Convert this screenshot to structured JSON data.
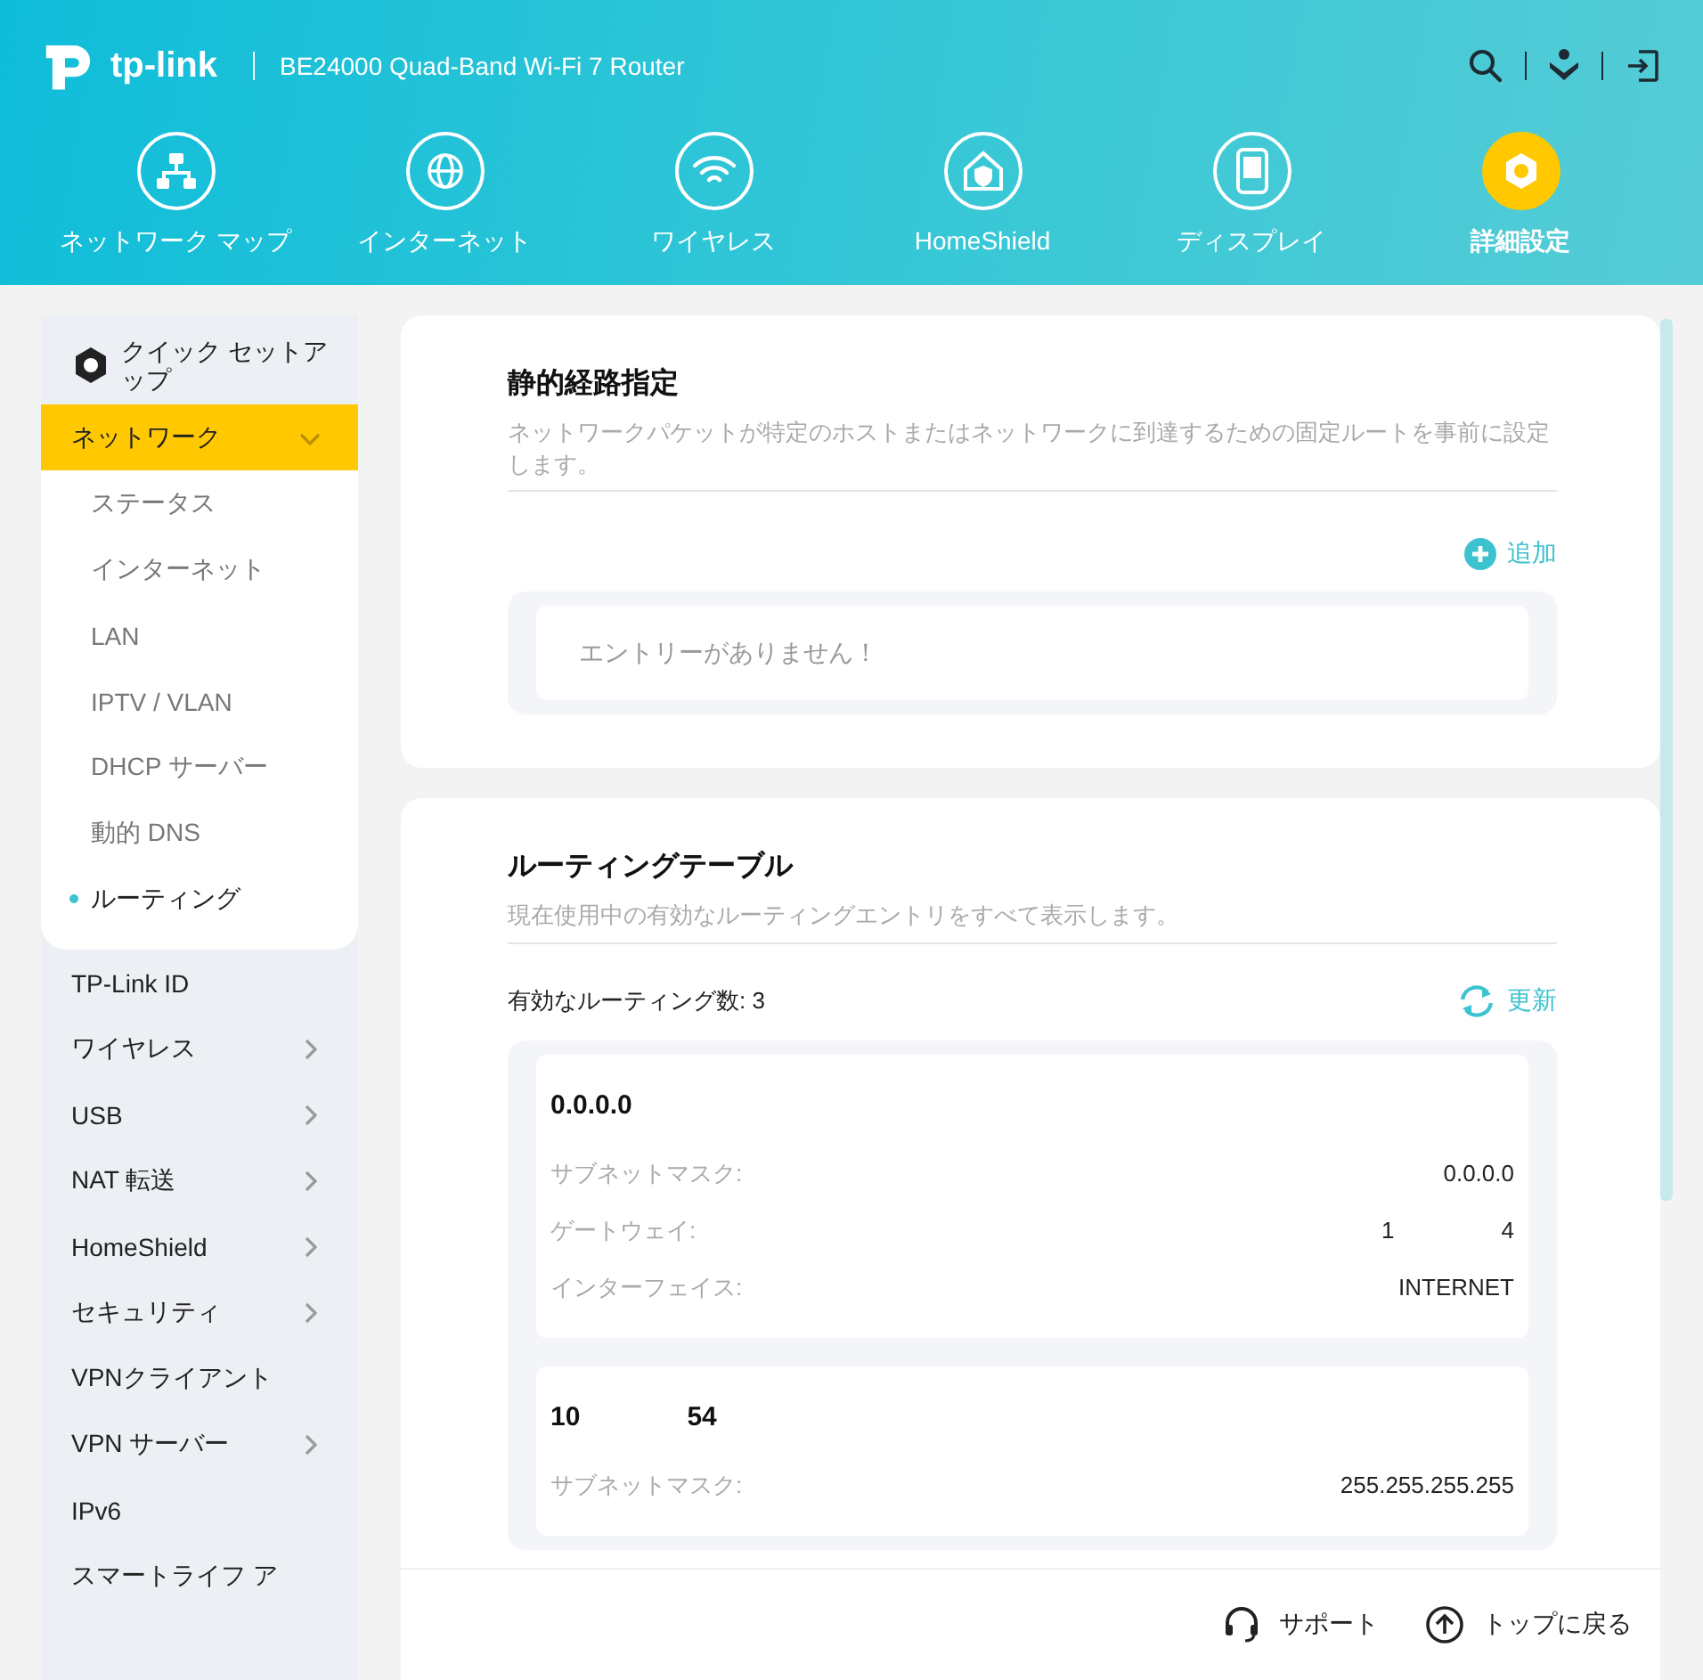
{
  "header": {
    "logo": "tp-link",
    "model": "BE24000 Quad-Band Wi-Fi 7 Router"
  },
  "nav_tabs": [
    {
      "label": "ネットワーク マップ",
      "kind": "map",
      "selected": false
    },
    {
      "label": "インターネット",
      "kind": "globe",
      "selected": false
    },
    {
      "label": "ワイヤレス",
      "kind": "wifi",
      "selected": false
    },
    {
      "label": "HomeShield",
      "kind": "home",
      "selected": false
    },
    {
      "label": "ディスプレイ",
      "kind": "display",
      "selected": false
    },
    {
      "label": "詳細設定",
      "kind": "gear",
      "selected": true
    }
  ],
  "sidebar": {
    "top": {
      "label": "クイック セットアップ"
    },
    "items": [
      {
        "label": "ネットワーク",
        "submenu": true,
        "expanded": true,
        "selected": true,
        "children": [
          {
            "label": "ステータス",
            "selected": false
          },
          {
            "label": "インターネット",
            "selected": false
          },
          {
            "label": "LAN",
            "selected": false
          },
          {
            "label": "IPTV / VLAN",
            "selected": false
          },
          {
            "label": "DHCP サーバー",
            "selected": false
          },
          {
            "label": "動的 DNS",
            "selected": false
          },
          {
            "label": "ルーティング",
            "selected": true
          }
        ]
      },
      {
        "label": "TP-Link ID",
        "submenu": false,
        "expanded": false,
        "selected": false
      },
      {
        "label": "ワイヤレス",
        "submenu": true,
        "expanded": false,
        "selected": false
      },
      {
        "label": "USB",
        "submenu": true,
        "expanded": false,
        "selected": false
      },
      {
        "label": "NAT 転送",
        "submenu": true,
        "expanded": false,
        "selected": false
      },
      {
        "label": "HomeShield",
        "submenu": true,
        "expanded": false,
        "selected": false
      },
      {
        "label": "セキュリティ",
        "submenu": true,
        "expanded": false,
        "selected": false
      },
      {
        "label": "VPNクライアント",
        "submenu": false,
        "expanded": false,
        "selected": false
      },
      {
        "label": "VPN サーバー",
        "submenu": true,
        "expanded": false,
        "selected": false
      },
      {
        "label": "IPv6",
        "submenu": false,
        "expanded": false,
        "selected": false
      },
      {
        "label": "スマートライフ ア",
        "submenu": false,
        "expanded": false,
        "selected": false
      }
    ]
  },
  "static_routing": {
    "title": "静的経路指定",
    "description": "ネットワークパケットが特定のホストまたはネットワークに到達するための固定ルートを事前に設定します。",
    "add_button": "追加",
    "empty_message": "エントリーがありません！"
  },
  "routing_table": {
    "title": "ルーティングテーブル",
    "description": "現在使用中の有効なルーティングエントリをすべて表示します。",
    "count_label": "有効なルーティング数: 3",
    "refresh_button": "更新",
    "entries": [
      {
        "title_parts": [
          "0.0.0.0"
        ],
        "fields": [
          {
            "label": "サブネットマスク:",
            "value_parts": [
              "0.0.0.0"
            ]
          },
          {
            "label": "ゲートウェイ:",
            "value_parts": [
              "1",
              "4"
            ]
          },
          {
            "label": "インターフェイス:",
            "value_parts": [
              "INTERNET"
            ]
          }
        ]
      },
      {
        "title_parts": [
          "10",
          "54"
        ],
        "fields": [
          {
            "label": "サブネットマスク:",
            "value_parts": [
              "255.255.255.255"
            ]
          }
        ]
      }
    ]
  },
  "footer": {
    "support": "サポート",
    "back_to_top": "トップに戻る"
  }
}
